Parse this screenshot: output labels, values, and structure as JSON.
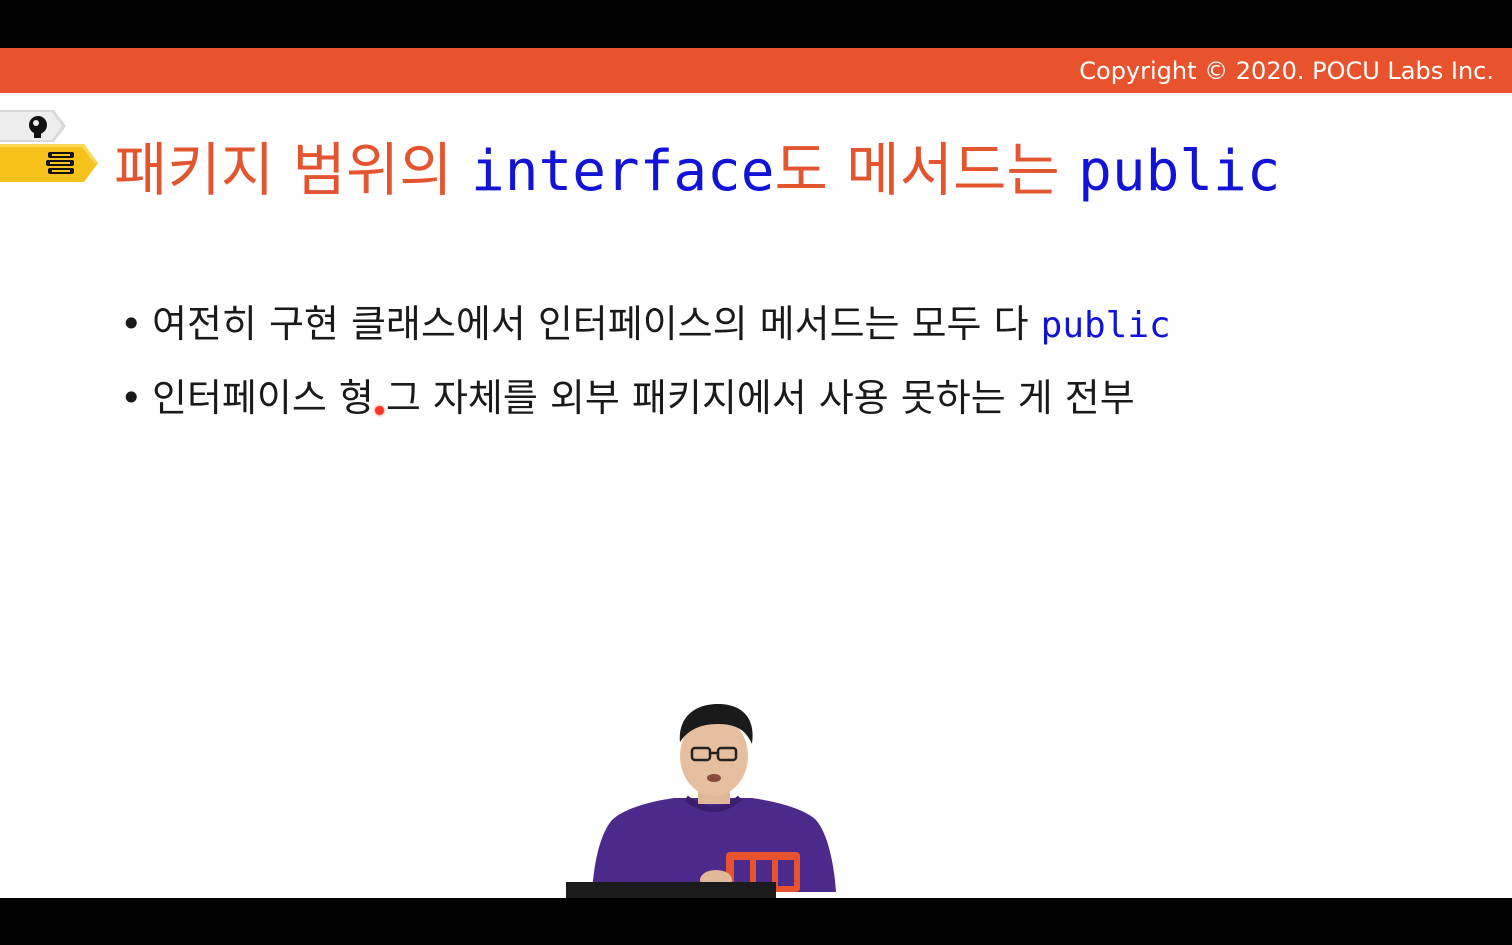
{
  "header": {
    "copyright": "Copyright © 2020. POCU Labs Inc.",
    "bar_color": "#e8532d"
  },
  "slide": {
    "title_part1": "패키지 범위의 ",
    "title_code1": "interface",
    "title_part2": "도 메서드는 ",
    "title_code2": "public",
    "bullets": [
      {
        "text": "여전히 구현 클래스에서 인터페이스의 메서드는 모두 다 ",
        "code": "public"
      },
      {
        "text": "인터페이스 형 그 자체를 외부 패키지에서 사용 못하는 게 전부"
      }
    ]
  },
  "icons": {
    "gray_tag": "head-brain-icon",
    "yellow_tag": "books-stack-icon"
  },
  "colors": {
    "title": "#e2552f",
    "code": "#1313d8",
    "tag_yellow": "#f7c21b",
    "tag_gray": "#d9d9d9",
    "pointer": "#ff3322"
  }
}
